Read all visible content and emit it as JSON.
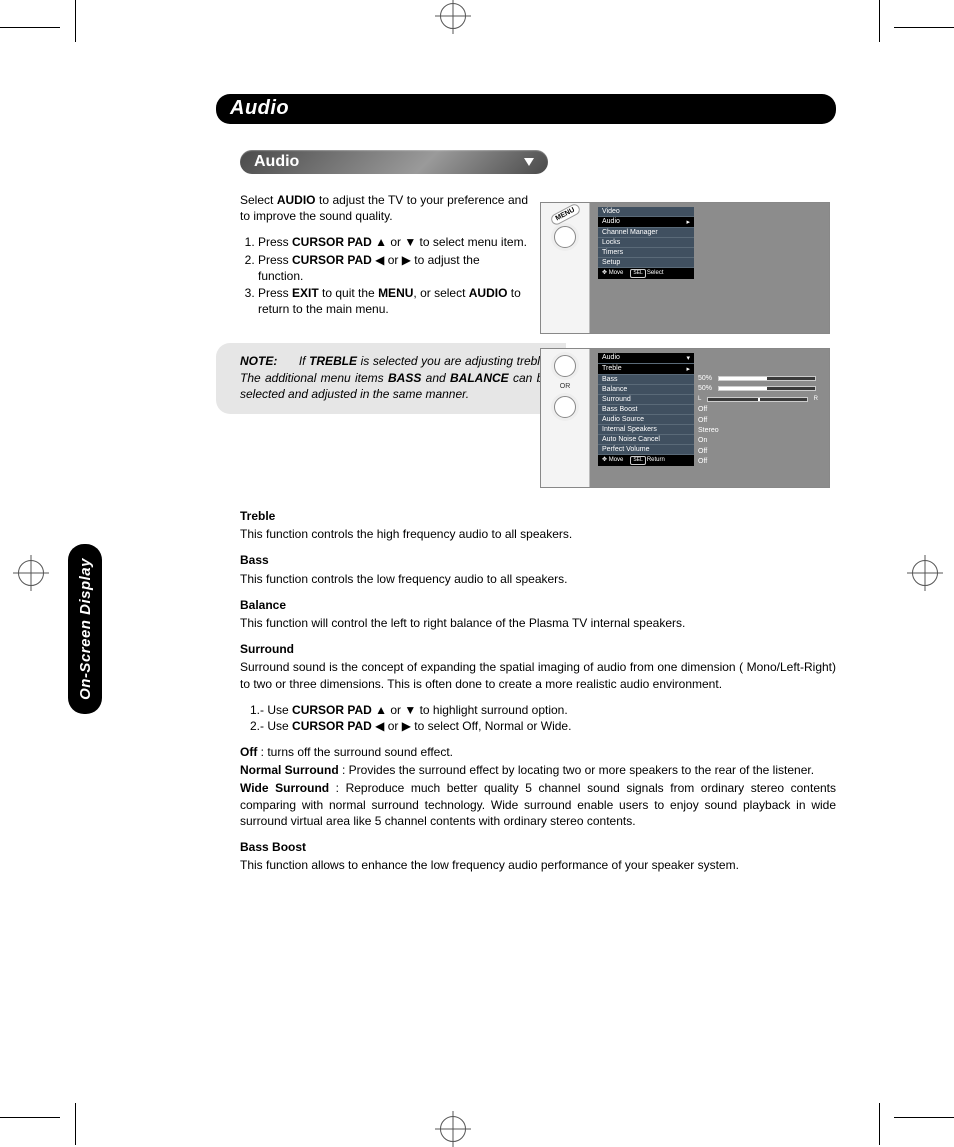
{
  "title": "Audio",
  "subtitle": "Audio",
  "side_tab": "On-Screen Display",
  "intro": {
    "pre": "Select ",
    "bold": "AUDIO",
    "post": " to adjust the TV to your preference and to improve the sound quality."
  },
  "steps": [
    {
      "pre": "Press ",
      "b1": "CURSOR PAD",
      "mid": "  ▲ or ▼ to select menu item."
    },
    {
      "pre": "Press ",
      "b1": "CURSOR PAD",
      "mid": " ◀ or ▶ to adjust the function."
    },
    {
      "pre": "Press ",
      "b1": "EXIT",
      "mid": " to quit the ",
      "b2": "MENU",
      "mid2": ", or select ",
      "b3": "AUDIO",
      "post": " to return to the main menu."
    }
  ],
  "note": {
    "label": "NOTE:",
    "text_pre": "If ",
    "b1": "TREBLE",
    "text_mid1": "  is selected you are adjusting treble.  The additional menu items ",
    "b2": "BASS",
    "text_mid2": " and ",
    "b3": "BALANCE",
    "text_post": " can be selected and adjusted in the same manner."
  },
  "fig1": {
    "btn_label": "MENU",
    "menu": [
      "Video",
      "Audio",
      "Channel Manager",
      "Locks",
      "Timers",
      "Setup"
    ],
    "selected_index": 1,
    "footer_move": "Move",
    "footer_sel": "Select",
    "sel_icon_text": "SEL"
  },
  "fig2": {
    "or_label": "OR",
    "header": "Audio",
    "rows": [
      {
        "label": "Treble",
        "value": "50%",
        "bar": 50,
        "selected": true
      },
      {
        "label": "Bass",
        "value": "50%",
        "bar": 50
      },
      {
        "label": "Balance",
        "value": "LR",
        "bar": 50,
        "lr": true
      },
      {
        "label": "Surround",
        "value": "Off"
      },
      {
        "label": "Bass Boost",
        "value": "Off"
      },
      {
        "label": "Audio Source",
        "value": "Stereo"
      },
      {
        "label": "Internal Speakers",
        "value": "On"
      },
      {
        "label": "Auto Noise Cancel",
        "value": "Off"
      },
      {
        "label": "Perfect Volume",
        "value": "Off"
      }
    ],
    "footer_move": "Move",
    "footer_ret": "Return",
    "sel_icon_text": "SEL"
  },
  "defs": {
    "treble": {
      "h": "Treble",
      "p": "This function controls the high frequency audio to all speakers."
    },
    "bass": {
      "h": "Bass",
      "p": "This function controls the low frequency audio to all speakers."
    },
    "balance": {
      "h": "Balance",
      "p": "This function will control the left to right balance of the Plasma TV internal speakers."
    },
    "surround": {
      "h": "Surround",
      "p": "Surround sound is the concept of expanding the spatial imaging of audio from one dimension ( Mono/Left-Right) to two or three dimensions. This is often done to create a more realistic audio environment.",
      "li1_pre": "Use ",
      "li1_b": "CURSOR PAD",
      "li1_post": " ▲ or ▼   to highlight surround option.",
      "li2_pre": "Use ",
      "li2_b": "CURSOR PAD",
      "li2_post": " ◀ or ▶  to select Off, Normal or Wide.",
      "off_b": "Off",
      "off_t": " : turns off the surround sound effect.",
      "ns_b": "Normal Surround",
      "ns_t": " :  Provides the surround effect by locating two or more speakers to the rear of the listener.",
      "ws_b": "Wide Surround",
      "ws_t": " : Reproduce much better quality 5 channel sound signals from ordinary stereo contents comparing with normal surround technology. Wide surround enable users to enjoy sound playback in wide surround virtual area like 5 channel contents with ordinary stereo contents."
    },
    "bboost": {
      "h": "Bass Boost",
      "p": "This function allows to enhance the low frequency audio performance of your speaker system."
    }
  }
}
